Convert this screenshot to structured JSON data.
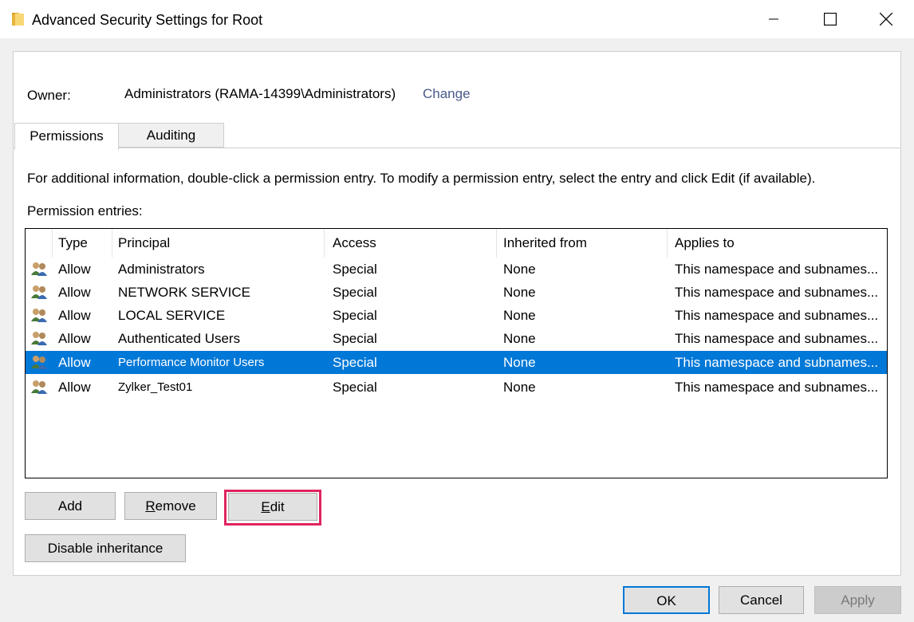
{
  "window": {
    "title": "Advanced Security Settings for Root"
  },
  "owner": {
    "label": "Owner:",
    "value": "Administrators (RAMA-14399\\Administrators)",
    "change_link": "Change"
  },
  "tabs": [
    {
      "label": "Permissions",
      "selected": true
    },
    {
      "label": "Auditing",
      "selected": false
    }
  ],
  "info_text": "For additional information, double-click a permission entry. To modify a permission entry, select the entry and click Edit (if available).",
  "entries_label": "Permission entries:",
  "table": {
    "columns": [
      "Type",
      "Principal",
      "Access",
      "Inherited from",
      "Applies to"
    ],
    "rows": [
      {
        "type": "Allow",
        "principal": "Administrators",
        "access": "Special",
        "inherited": "None",
        "applies": "This namespace and subnames..."
      },
      {
        "type": "Allow",
        "principal": "NETWORK SERVICE",
        "access": "Special",
        "inherited": "None",
        "applies": "This namespace and subnames..."
      },
      {
        "type": "Allow",
        "principal": "LOCAL SERVICE",
        "access": "Special",
        "inherited": "None",
        "applies": "This namespace and subnames..."
      },
      {
        "type": "Allow",
        "principal": "Authenticated Users",
        "access": "Special",
        "inherited": "None",
        "applies": "This namespace and subnames..."
      },
      {
        "type": "Allow",
        "principal": "Performance Monitor Users",
        "access": "Special",
        "inherited": "None",
        "applies": "This namespace and subnames..."
      },
      {
        "type": "Allow",
        "principal": "Zylker_Test01",
        "access": "Special",
        "inherited": "None",
        "applies": "This namespace and subnames..."
      }
    ],
    "selected_row": 4
  },
  "buttons": {
    "add": "Add",
    "remove_rest": "emove",
    "remove_key": "R",
    "edit_key": "E",
    "edit_rest": "dit",
    "disable_inheritance": "Disable inheritance",
    "ok": "OK",
    "cancel": "Cancel",
    "apply": "Apply"
  },
  "colors": {
    "selection": "#0078d7",
    "highlight_border": "#e0245e",
    "link": "#4a5a8a"
  },
  "icons": {
    "title": "folder-icon",
    "row": "users-icon"
  }
}
